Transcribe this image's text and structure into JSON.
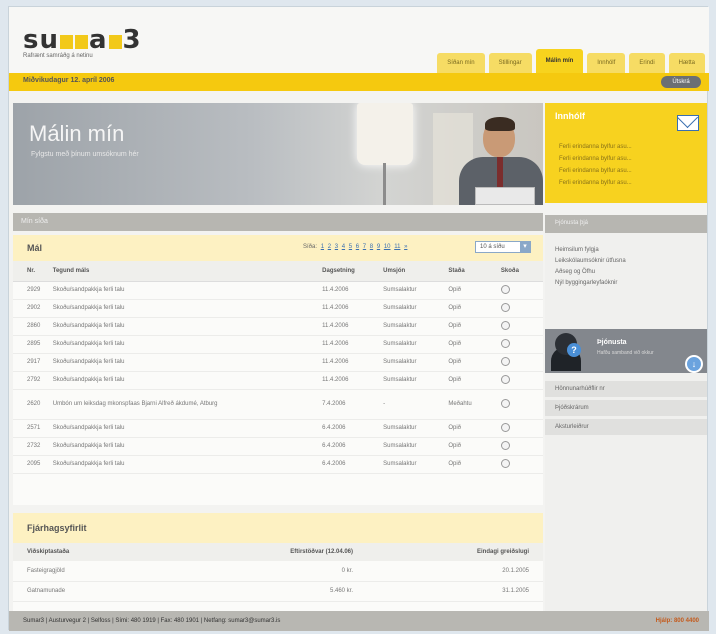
{
  "logo": {
    "name": "su    a  3",
    "tagline": "Rafrænt samráðg á netinu"
  },
  "tabs": [
    {
      "label": "Síðan mín",
      "active": false
    },
    {
      "label": "Stillingar",
      "active": false
    },
    {
      "label": "Málin mín",
      "active": true
    },
    {
      "label": "Innhólf",
      "active": false
    },
    {
      "label": "Erindi",
      "active": false
    },
    {
      "label": "Hætta",
      "active": false
    }
  ],
  "datebar": {
    "date": "Miðvikudagur 12. apríl 2006",
    "logout_label": "Útskrá"
  },
  "hero": {
    "title": "Málin mín",
    "subtitle": "Fylgstu með þínum umsóknum hér"
  },
  "inbox": {
    "title": "Innhólf",
    "messages": [
      "Ferli erindanna bylfur asu...",
      "Ferli erindanna bylfur asu...",
      "Ferli erindanna bylfur asu...",
      "Ferli erindanna bylfur asu..."
    ]
  },
  "section_bar": {
    "label": "Mín síða"
  },
  "mal": {
    "title": "Mál",
    "pager_label": "Síða:",
    "pages": [
      "1",
      "2",
      "3",
      "4",
      "5",
      "6",
      "7",
      "8",
      "9",
      "10",
      "11",
      "»"
    ],
    "per_page": "10 á síðu",
    "columns": [
      "Nr.",
      "Tegund máls",
      "Dagsetning",
      "Umsjón",
      "Staða",
      "Skoða"
    ],
    "rows": [
      {
        "nr": "2929",
        "type": "Skoðu/sandpakkja ferli talu",
        "date": "11.4.2006",
        "owner": "Sumsalaktur",
        "status": "Opið",
        "tall": false
      },
      {
        "nr": "2902",
        "type": "Skoðu/sandpakkja ferli talu",
        "date": "11.4.2006",
        "owner": "Sumsalaktur",
        "status": "Opið",
        "tall": false
      },
      {
        "nr": "2860",
        "type": "Skoðu/sandpakkja ferli talu",
        "date": "11.4.2006",
        "owner": "Sumsalaktur",
        "status": "Opið",
        "tall": false
      },
      {
        "nr": "2895",
        "type": "Skoðu/sandpakkja ferli talu",
        "date": "11.4.2006",
        "owner": "Sumsalaktur",
        "status": "Opið",
        "tall": false
      },
      {
        "nr": "2917",
        "type": "Skoðu/sandpakkja ferli talu",
        "date": "11.4.2006",
        "owner": "Sumsalaktur",
        "status": "Opið",
        "tall": false
      },
      {
        "nr": "2792",
        "type": "Skoðu/sandpakkja ferli talu",
        "date": "11.4.2006",
        "owner": "Sumsalaktur",
        "status": "Opið",
        "tall": false
      },
      {
        "nr": "2620",
        "type": "Umbón um leiksdag mkonspfaas Bjarni Alfreð ákdumé, Atburg",
        "date": "7.4.2006",
        "owner": "-",
        "status": "Meðahtu",
        "tall": true
      },
      {
        "nr": "2571",
        "type": "Skoðu/sandpakkja ferli talu",
        "date": "6.4.2006",
        "owner": "Sumsalaktur",
        "status": "Opið",
        "tall": false
      },
      {
        "nr": "2732",
        "type": "Skoðu/sandpakkja ferli talu",
        "date": "6.4.2006",
        "owner": "Sumsalaktur",
        "status": "Opið",
        "tall": false
      },
      {
        "nr": "2095",
        "type": "Skoðu/sandpakkja ferli talu",
        "date": "6.4.2006",
        "owner": "Sumsalaktur",
        "status": "Opið",
        "tall": false
      }
    ]
  },
  "fjar": {
    "title": "Fjárhagsyfirlit",
    "columns": [
      "Viðskiptastaða",
      "Eftirstöðvar (12.04.06)",
      "Eindagi greiðslugi"
    ],
    "rows": [
      {
        "name": "Fasteigragjöld",
        "amount": "0 kr.",
        "due": "20.1.2005"
      },
      {
        "name": "Gatnamunade",
        "amount": "5.460 kr.",
        "due": "31.1.2005"
      }
    ]
  },
  "side": {
    "bar_label": "Þjónusta þjá",
    "links": [
      "Heimsilum fylgja",
      "Leikskólaumsóknir útfusna",
      "Aðseg og Öfhu",
      "Nýl byggingarleyfaóknir"
    ],
    "service_title": "Þjónusta",
    "service_subtitle": "Hafðu samband við okkur",
    "items": [
      "Hönnunarhúðflir nr",
      "Þjóðskrárum",
      "Aksturleiðrur"
    ]
  },
  "footer": {
    "info": "Sumar3 | Austurvegur 2 | Selfoss | Sími: 480 1919 | Fax: 480 1901 | Netfang: sumar3@sumar3.is",
    "help": "Hjálp: 800 4400"
  }
}
